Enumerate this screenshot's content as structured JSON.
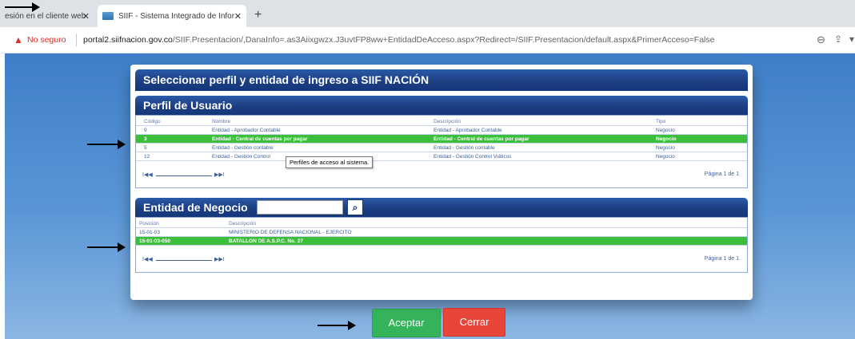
{
  "browser": {
    "tabs": [
      {
        "title": "esión en el cliente web",
        "close": "✕"
      },
      {
        "title": "SIIF - Sistema Integrado de Infor",
        "close": "✕"
      }
    ],
    "new_tab": "+",
    "security_label": "No seguro",
    "url_host": "portal2.siifnacion.gov.co",
    "url_path": "/SIIF.Presentacion/,DanaInfo=.as3Aiixgwzx.J3uvtFP8ww+EntidadDeAcceso.aspx?Redirect=/SIIF.Presentacion/default.aspx&PrimerAcceso=False",
    "icons": {
      "warning": "warning-icon",
      "zoom": "zoom-icon",
      "share": "share-icon"
    }
  },
  "dialog": {
    "title": "Seleccionar perfil y entidad de ingreso a SIIF NACIÓN",
    "profile_section": {
      "title": "Perfil de Usuario",
      "columns": [
        "Código",
        "Nombre",
        "Descripción",
        "Tipo"
      ],
      "rows": [
        {
          "code": "9",
          "name": "Entidad - Aprobador Contable",
          "desc": "Entidad - Aprobador Contable",
          "type": "Negocio"
        },
        {
          "code": "3",
          "name": "Entidad - Central de cuentas por pagar",
          "desc": "Entidad - Central de cuentas por pagar",
          "type": "Negocio"
        },
        {
          "code": "5",
          "name": "Entidad - Gestión contable",
          "desc": "Entidad - Gestión contable",
          "type": "Negocio"
        },
        {
          "code": "12",
          "name": "Entidad - Gestión Control",
          "desc": "Entidad - Gestión Control Viáticos",
          "type": "Negocio"
        }
      ],
      "tooltip": "Perfiles de acceso al sistema.",
      "pager_prev": "I◀◀",
      "pager_next": "▶▶I",
      "page_info": "Página 1 de 1"
    },
    "entity_section": {
      "title": "Entidad de Negocio",
      "search_value": "",
      "columns": [
        "Posición",
        "Descripción"
      ],
      "rows": [
        {
          "pos": "15-01-03",
          "desc": "MINISTERIO DE DEFENSA NACIONAL - EJERCITO"
        },
        {
          "pos": "15-01-03-050",
          "desc": "BATALLON DE A.S.P.C. No. 27"
        }
      ],
      "pager_prev": "I◀◀",
      "pager_next": "▶▶I",
      "page_info": "Página 1 de 1"
    }
  },
  "buttons": {
    "accept": "Aceptar",
    "close": "Cerrar"
  },
  "colors": {
    "header": "#1c3f82",
    "selected_row": "#3bbf3a",
    "accept": "#34b35b",
    "close": "#e8463b"
  }
}
